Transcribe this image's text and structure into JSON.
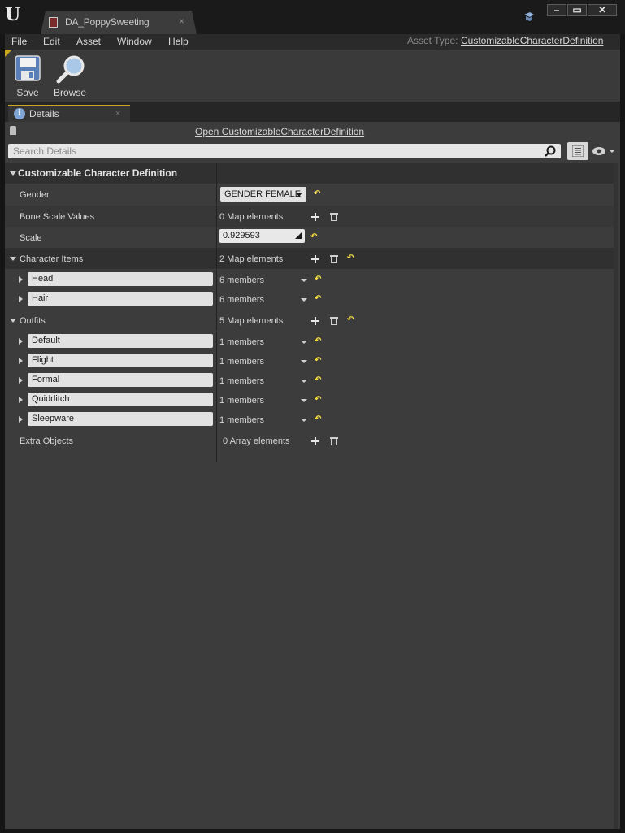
{
  "window": {
    "tab_title": "DA_PoppySweeting",
    "tab_close": "×",
    "minimize": "–",
    "maximize": "▭",
    "close": "✕"
  },
  "menu": {
    "items": [
      "File",
      "Edit",
      "Asset",
      "Window",
      "Help"
    ],
    "asset_type_label": "Asset Type:",
    "asset_type_value": "CustomizableCharacterDefinition"
  },
  "toolbar": {
    "save_label": "Save",
    "browse_label": "Browse"
  },
  "details": {
    "tab_label": "Details",
    "tab_close": "×",
    "open_link": "Open CustomizableCharacterDefinition",
    "search_placeholder": "Search Details",
    "category": "Customizable Character Definition",
    "gender_label": "Gender",
    "gender_value": "GENDER FEMALE",
    "bone_scale_label": "Bone Scale Values",
    "bone_scale_value": "0 Map elements",
    "scale_label": "Scale",
    "scale_value": "0.929593",
    "character_items_label": "Character Items",
    "character_items_value": "2 Map elements",
    "character_items": [
      {
        "key": "Head",
        "value": "6 members"
      },
      {
        "key": "Hair",
        "value": "6 members"
      }
    ],
    "outfits_label": "Outfits",
    "outfits_value": "5 Map elements",
    "outfits": [
      {
        "key": "Default",
        "value": "1 members"
      },
      {
        "key": "Flight",
        "value": "1 members"
      },
      {
        "key": "Formal",
        "value": "1 members"
      },
      {
        "key": "Quidditch",
        "value": "1 members"
      },
      {
        "key": "Sleepware",
        "value": "1 members"
      }
    ],
    "extra_objects_label": "Extra Objects",
    "extra_objects_value": "0 Array elements"
  },
  "icons": {
    "reset": "↶",
    "accent": "#c9a71f",
    "reset_color": "#f5de46"
  }
}
